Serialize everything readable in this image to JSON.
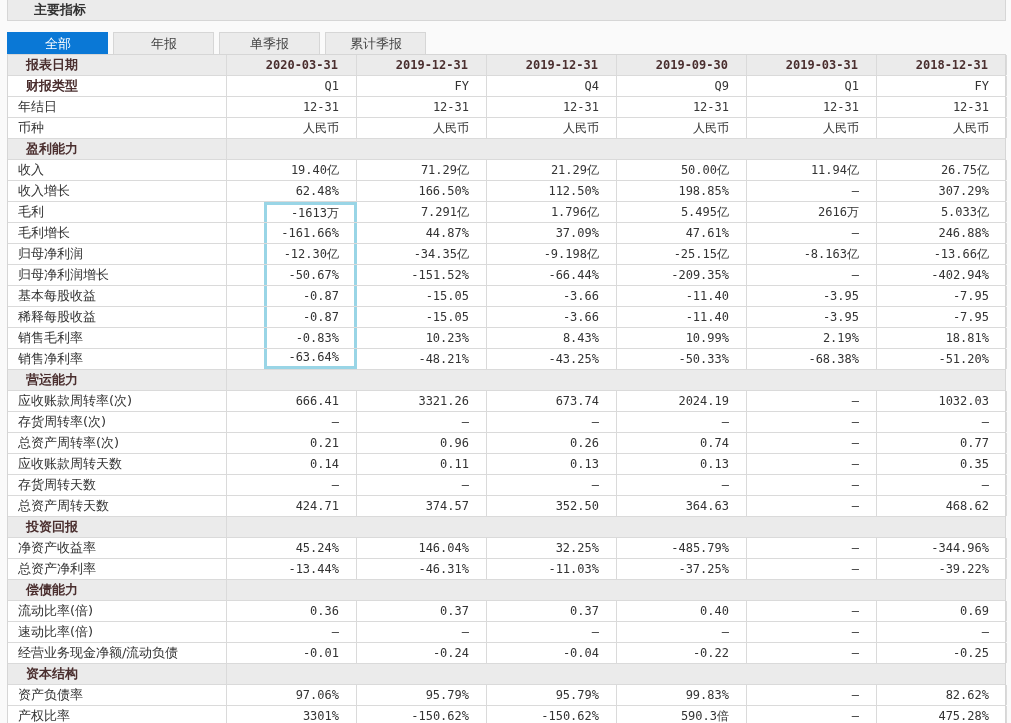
{
  "title": "主要指标",
  "tabs": [
    {
      "label": "全部",
      "selected": true
    },
    {
      "label": "年报",
      "selected": false
    },
    {
      "label": "单季报",
      "selected": false
    },
    {
      "label": "累计季报",
      "selected": false
    }
  ],
  "table": {
    "columns": [
      "报表日期",
      "2020-03-31",
      "2019-12-31",
      "2019-12-31",
      "2019-09-30",
      "2019-03-31",
      "2018-12-31"
    ],
    "rows": [
      {
        "kind": "bold",
        "label": "财报类型",
        "values": [
          "Q1",
          "FY",
          "Q4",
          "Q9",
          "Q1",
          "FY"
        ],
        "highlighted": false
      },
      {
        "kind": "plain",
        "label": "年结日",
        "values": [
          "12-31",
          "12-31",
          "12-31",
          "12-31",
          "12-31",
          "12-31"
        ],
        "highlighted": false
      },
      {
        "kind": "plain",
        "label": "币种",
        "values": [
          "人民币",
          "人民币",
          "人民币",
          "人民币",
          "人民币",
          "人民币"
        ],
        "highlighted": false
      },
      {
        "kind": "section",
        "label": "盈利能力"
      },
      {
        "kind": "plain",
        "label": "收入",
        "values": [
          "19.40亿",
          "71.29亿",
          "21.29亿",
          "50.00亿",
          "11.94亿",
          "26.75亿"
        ],
        "highlighted": false
      },
      {
        "kind": "plain",
        "label": "收入增长",
        "values": [
          "62.48%",
          "166.50%",
          "112.50%",
          "198.85%",
          "—",
          "307.29%"
        ],
        "highlighted": false
      },
      {
        "kind": "plain",
        "label": "毛利",
        "values": [
          "-1613万",
          "7.291亿",
          "1.796亿",
          "5.495亿",
          "2616万",
          "5.033亿"
        ],
        "highlighted": true
      },
      {
        "kind": "plain",
        "label": "毛利增长",
        "values": [
          "-161.66%",
          "44.87%",
          "37.09%",
          "47.61%",
          "—",
          "246.88%"
        ],
        "highlighted": true
      },
      {
        "kind": "plain",
        "label": "归母净利润",
        "values": [
          "-12.30亿",
          "-34.35亿",
          "-9.198亿",
          "-25.15亿",
          "-8.163亿",
          "-13.66亿"
        ],
        "highlighted": true
      },
      {
        "kind": "plain",
        "label": "归母净利润增长",
        "values": [
          "-50.67%",
          "-151.52%",
          "-66.44%",
          "-209.35%",
          "—",
          "-402.94%"
        ],
        "highlighted": true
      },
      {
        "kind": "plain",
        "label": "基本每股收益",
        "values": [
          "-0.87",
          "-15.05",
          "-3.66",
          "-11.40",
          "-3.95",
          "-7.95"
        ],
        "highlighted": true
      },
      {
        "kind": "plain",
        "label": "稀释每股收益",
        "values": [
          "-0.87",
          "-15.05",
          "-3.66",
          "-11.40",
          "-3.95",
          "-7.95"
        ],
        "highlighted": true
      },
      {
        "kind": "plain",
        "label": "销售毛利率",
        "values": [
          "-0.83%",
          "10.23%",
          "8.43%",
          "10.99%",
          "2.19%",
          "18.81%"
        ],
        "highlighted": true
      },
      {
        "kind": "plain",
        "label": "销售净利率",
        "values": [
          "-63.64%",
          "-48.21%",
          "-43.25%",
          "-50.33%",
          "-68.38%",
          "-51.20%"
        ],
        "highlighted": true
      },
      {
        "kind": "section",
        "label": "营运能力"
      },
      {
        "kind": "plain",
        "label": "应收账款周转率(次)",
        "values": [
          "666.41",
          "3321.26",
          "673.74",
          "2024.19",
          "—",
          "1032.03"
        ],
        "highlighted": false
      },
      {
        "kind": "plain",
        "label": "存货周转率(次)",
        "values": [
          "—",
          "—",
          "—",
          "—",
          "—",
          "—"
        ],
        "highlighted": false
      },
      {
        "kind": "plain",
        "label": "总资产周转率(次)",
        "values": [
          "0.21",
          "0.96",
          "0.26",
          "0.74",
          "—",
          "0.77"
        ],
        "highlighted": false
      },
      {
        "kind": "plain",
        "label": "应收账款周转天数",
        "values": [
          "0.14",
          "0.11",
          "0.13",
          "0.13",
          "—",
          "0.35"
        ],
        "highlighted": false
      },
      {
        "kind": "plain",
        "label": "存货周转天数",
        "values": [
          "—",
          "—",
          "—",
          "—",
          "—",
          "—"
        ],
        "highlighted": false
      },
      {
        "kind": "plain",
        "label": "总资产周转天数",
        "values": [
          "424.71",
          "374.57",
          "352.50",
          "364.63",
          "—",
          "468.62"
        ],
        "highlighted": false
      },
      {
        "kind": "section",
        "label": "投资回报"
      },
      {
        "kind": "plain",
        "label": "净资产收益率",
        "values": [
          "45.24%",
          "146.04%",
          "32.25%",
          "-485.79%",
          "—",
          "-344.96%"
        ],
        "highlighted": false
      },
      {
        "kind": "plain",
        "label": "总资产净利率",
        "values": [
          "-13.44%",
          "-46.31%",
          "-11.03%",
          "-37.25%",
          "—",
          "-39.22%"
        ],
        "highlighted": false
      },
      {
        "kind": "section",
        "label": "偿债能力"
      },
      {
        "kind": "plain",
        "label": "流动比率(倍)",
        "values": [
          "0.36",
          "0.37",
          "0.37",
          "0.40",
          "—",
          "0.69"
        ],
        "highlighted": false
      },
      {
        "kind": "plain",
        "label": "速动比率(倍)",
        "values": [
          "—",
          "—",
          "—",
          "—",
          "—",
          "—"
        ],
        "highlighted": false
      },
      {
        "kind": "plain",
        "label": "经营业务现金净额/流动负债",
        "values": [
          "-0.01",
          "-0.24",
          "-0.04",
          "-0.22",
          "—",
          "-0.25"
        ],
        "highlighted": false
      },
      {
        "kind": "section",
        "label": "资本结构"
      },
      {
        "kind": "plain",
        "label": "资产负债率",
        "values": [
          "97.06%",
          "95.79%",
          "95.79%",
          "99.83%",
          "—",
          "82.62%"
        ],
        "highlighted": false
      },
      {
        "kind": "plain",
        "label": "产权比率",
        "values": [
          "3301%",
          "-150.62%",
          "-150.62%",
          "590.3倍",
          "—",
          "475.28%"
        ],
        "highlighted": false
      }
    ]
  }
}
